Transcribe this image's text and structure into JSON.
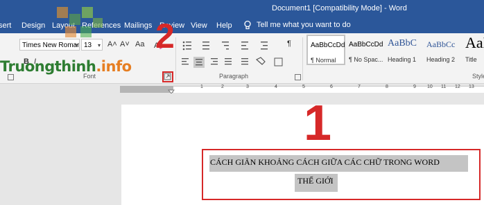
{
  "window": {
    "title": "Document1 [Compatibility Mode]  -  Word"
  },
  "tabs": [
    "sert",
    "Design",
    "Layout",
    "References",
    "Mailings",
    "Review",
    "View",
    "Help"
  ],
  "tell_me": "Tell me what you want to do",
  "font": {
    "name": "Times New Roman",
    "size": "13",
    "grow_label": "A˄",
    "shrink_label": "A˅",
    "case_label": "Aa",
    "bold_label": "B",
    "italic_label": "I",
    "group_label": "Font"
  },
  "paragraph": {
    "group_label": "Paragraph",
    "show_marks": "¶"
  },
  "styles": {
    "group_label": "Styles",
    "items": [
      {
        "sample": "AaBbCcDd",
        "name": "¶ Normal",
        "selected": true
      },
      {
        "sample": "AaBbCcDd",
        "name": "¶ No Spac...",
        "selected": false
      },
      {
        "sample": "AaBbC",
        "name": "Heading 1",
        "selected": false
      },
      {
        "sample": "AaBbCc",
        "name": "Heading 2",
        "selected": false
      },
      {
        "sample": "AaB",
        "name": "Title",
        "selected": false
      }
    ]
  },
  "ruler": {
    "numbers": [
      "1",
      "2",
      "3",
      "4",
      "5",
      "6",
      "7",
      "8",
      "9",
      "10",
      "11",
      "12",
      "13"
    ]
  },
  "document": {
    "line1": "CÁCH GIÃN KHOẢNG CÁCH GIỮA CÁC CHỮ TRONG WORD",
    "line2": "THẾ GIỚI"
  },
  "annotations": {
    "marker_1": "1",
    "marker_2": "2",
    "color": "#d62828"
  },
  "watermark": {
    "text_part1": "Truongthinh",
    "text_part2": ".info"
  },
  "colors": {
    "word_blue": "#2b579a",
    "ribbon": "#f3f3f3",
    "highlight": "#c4c4c4"
  }
}
